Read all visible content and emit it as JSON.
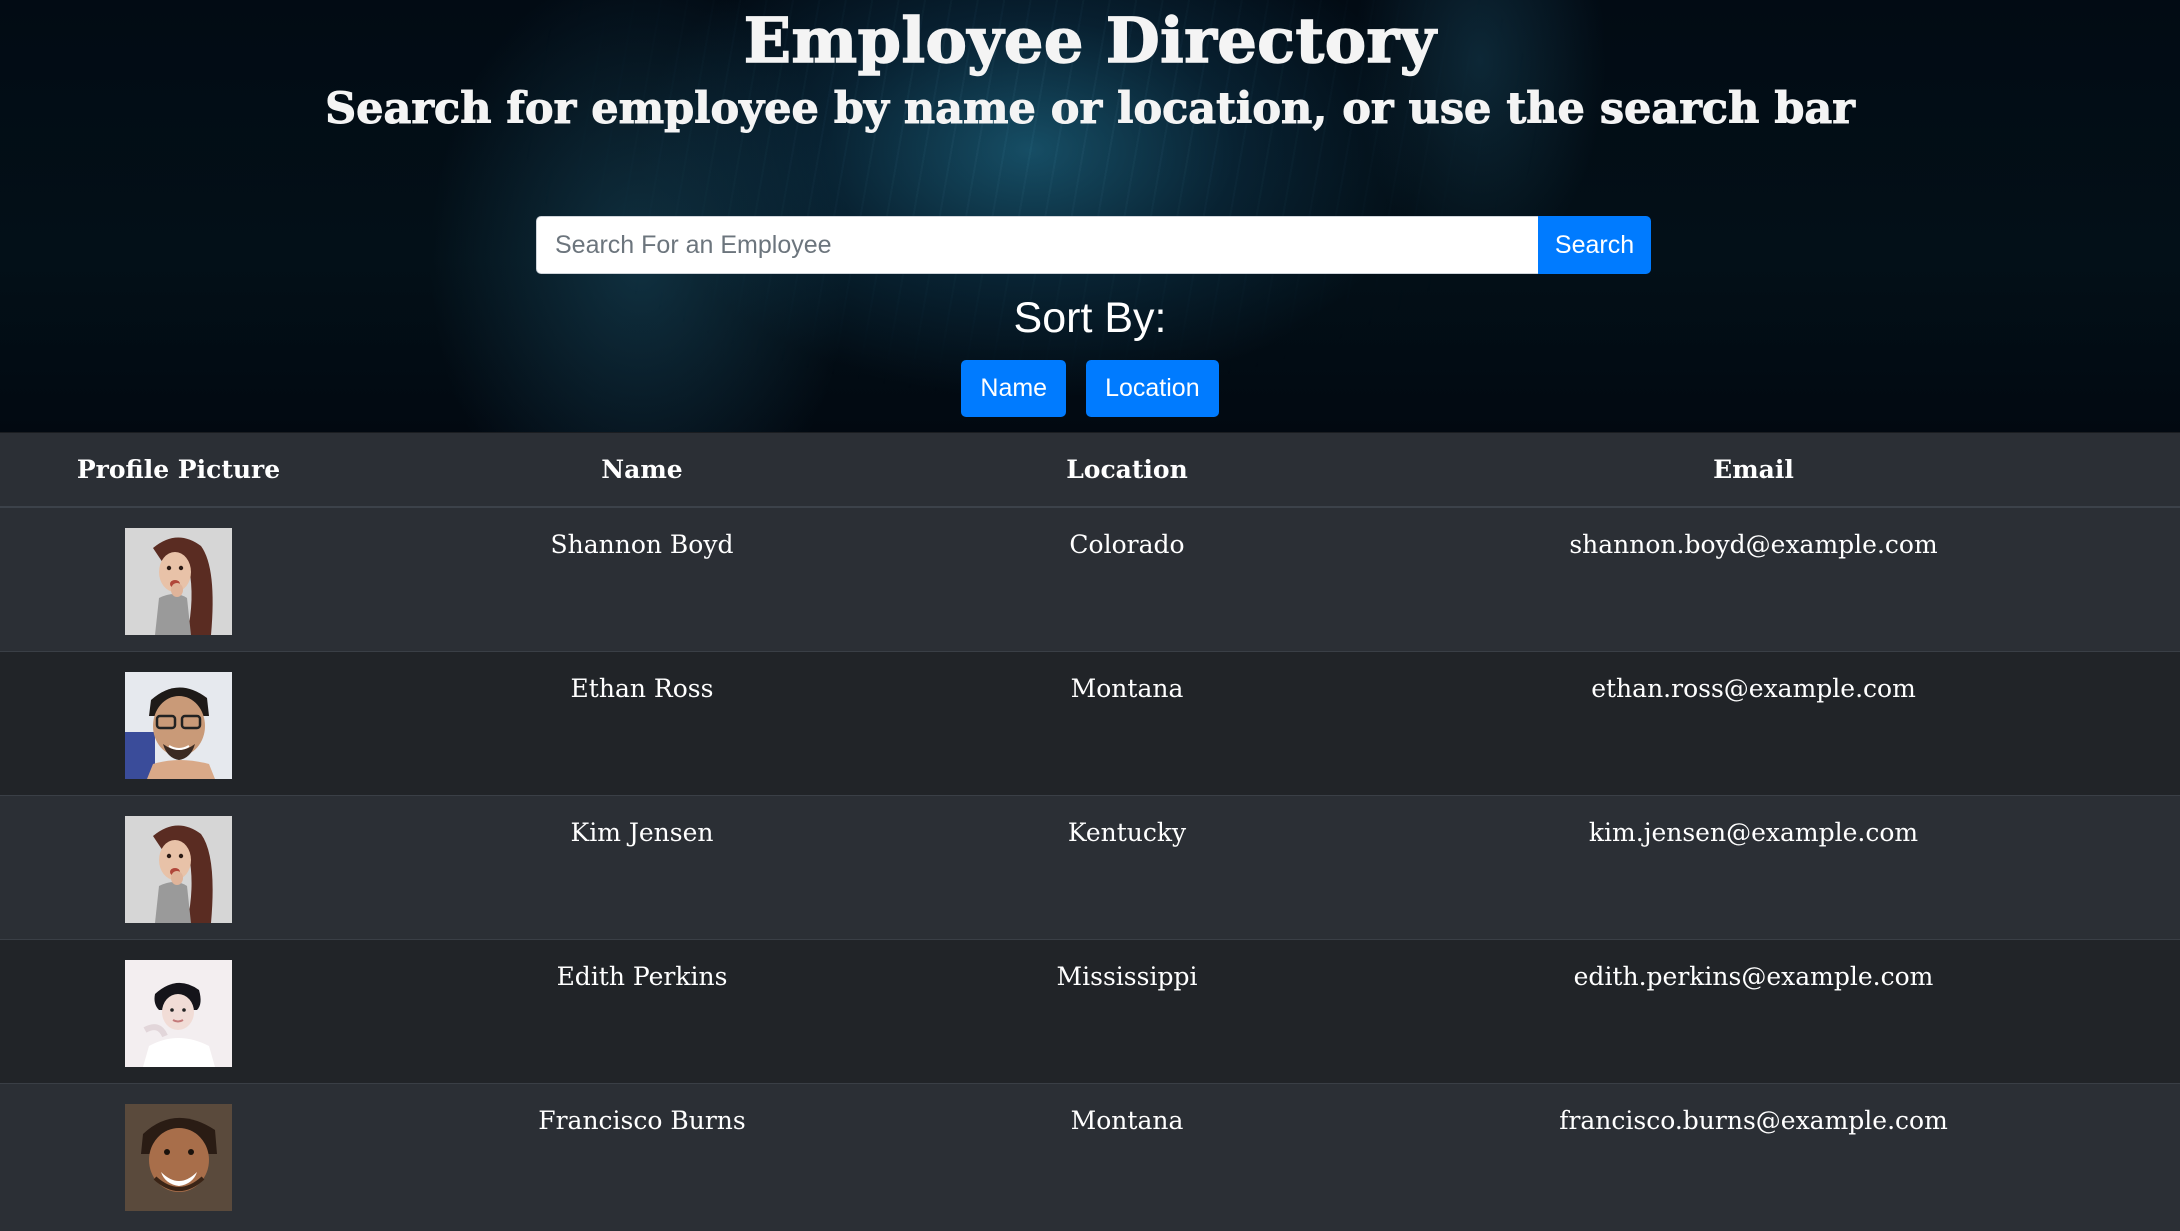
{
  "header": {
    "title": "Employee Directory",
    "subtitle": "Search for employee by name or location, or use the search bar"
  },
  "search": {
    "placeholder": "Search For an Employee",
    "value": "",
    "button_label": "Search"
  },
  "sort": {
    "label": "Sort By:",
    "buttons": [
      "Name",
      "Location"
    ]
  },
  "table": {
    "columns": [
      "Profile Picture",
      "Name",
      "Location",
      "Email"
    ],
    "rows": [
      {
        "avatar": "woman-surprised-photo",
        "name": "Shannon Boyd",
        "location": "Colorado",
        "email": "shannon.boyd@example.com"
      },
      {
        "avatar": "man-glasses-photo",
        "name": "Ethan Ross",
        "location": "Montana",
        "email": "ethan.ross@example.com"
      },
      {
        "avatar": "woman-surprised-photo",
        "name": "Kim Jensen",
        "location": "Kentucky",
        "email": "kim.jensen@example.com"
      },
      {
        "avatar": "person-white-background-photo",
        "name": "Edith Perkins",
        "location": "Mississippi",
        "email": "edith.perkins@example.com"
      },
      {
        "avatar": "man-smiling-photo",
        "name": "Francisco Burns",
        "location": "Montana",
        "email": "francisco.burns@example.com"
      }
    ]
  },
  "colors": {
    "accent": "#007bff",
    "table_row_dark": "#212428",
    "table_row_light": "#2b2f35",
    "hero_background": "#031018"
  }
}
